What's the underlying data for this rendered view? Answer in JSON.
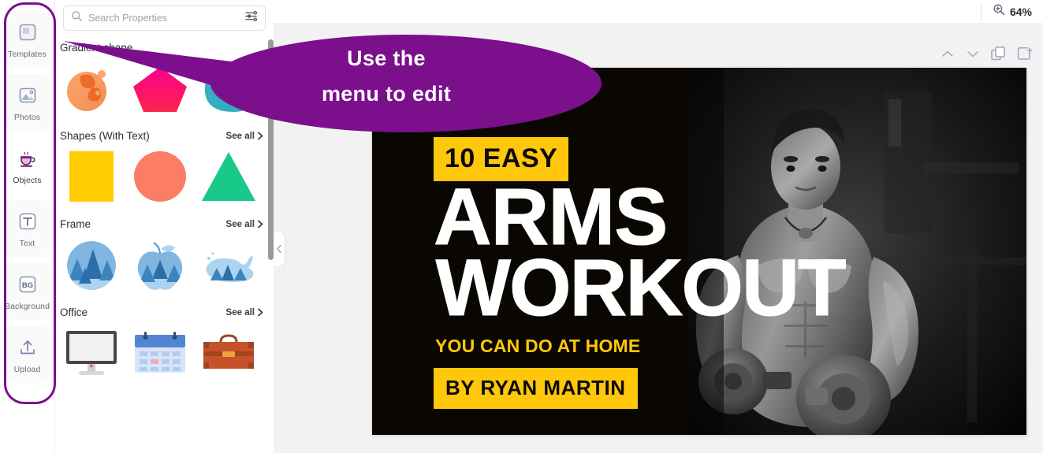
{
  "sidebar": {
    "items": [
      {
        "label": "Templates",
        "icon": "templates-icon",
        "active": false
      },
      {
        "label": "Photos",
        "icon": "photos-icon",
        "active": false
      },
      {
        "label": "Objects",
        "icon": "objects-icon",
        "active": true
      },
      {
        "label": "Text",
        "icon": "text-icon",
        "active": false
      },
      {
        "label": "Background",
        "icon": "background-icon",
        "active": false
      },
      {
        "label": "Upload",
        "icon": "upload-icon",
        "active": false
      }
    ],
    "highlight_color": "#7b0f8c"
  },
  "search": {
    "placeholder": "Search Properties",
    "value": "",
    "icon": "search-icon",
    "filter_icon": "filter-sliders-icon"
  },
  "panel": {
    "see_all_label": "See all",
    "sections": [
      {
        "title": "Gradient shape",
        "has_see_all": false,
        "thumbs": [
          {
            "name": "gradient-blob-orange",
            "color": "#F79256"
          },
          {
            "name": "gradient-pentagon-pink",
            "color": "#FF0080"
          },
          {
            "name": "gradient-bean-teal",
            "color": "#34B3C9"
          }
        ]
      },
      {
        "title": "Shapes (With Text)",
        "has_see_all": true,
        "thumbs": [
          {
            "name": "shape-square-yellow",
            "color": "#FFCC00"
          },
          {
            "name": "shape-circle-salmon",
            "color": "#FB7E64"
          },
          {
            "name": "shape-triangle-green",
            "color": "#18C98A"
          }
        ]
      },
      {
        "title": "Frame",
        "has_see_all": true,
        "thumbs": [
          {
            "name": "frame-circle-forest",
            "color": "#7FB3DE"
          },
          {
            "name": "frame-apple-forest",
            "color": "#7FB3DE"
          },
          {
            "name": "frame-whale",
            "color": "#7FB3DE"
          }
        ]
      },
      {
        "title": "Office",
        "has_see_all": true,
        "thumbs": [
          {
            "name": "office-monitor",
            "color": "#474747"
          },
          {
            "name": "office-calendar",
            "color": "#5285D0"
          },
          {
            "name": "office-briefcase",
            "color": "#C6522A"
          }
        ]
      }
    ],
    "collapse_icon": "chevron-left-icon",
    "scrollbar": "panel-scrollbar"
  },
  "topbar": {
    "zoom_icon": "zoom-in-icon",
    "zoom_level": "64%"
  },
  "page_tools": [
    {
      "name": "move-page-up-button",
      "icon": "chevron-up-icon"
    },
    {
      "name": "move-page-down-button",
      "icon": "chevron-down-icon"
    },
    {
      "name": "duplicate-page-button",
      "icon": "duplicate-icon"
    },
    {
      "name": "add-page-button",
      "icon": "add-page-icon"
    }
  ],
  "design": {
    "headline_badge": "10 EASY",
    "title_line1": "ARMS",
    "title_line2": "WORKOUT",
    "subtitle": "YOU CAN DO AT HOME",
    "author_badge": "BY RYAN MARTIN",
    "accent_color": "#FFC709",
    "background_color": "#0a0702",
    "photo_alt": "black and white photo of a muscular man holding two dumbbells in a gym"
  },
  "callout": {
    "line1": "Use the",
    "line2": "menu to edit",
    "color": "#7B0F8C"
  }
}
